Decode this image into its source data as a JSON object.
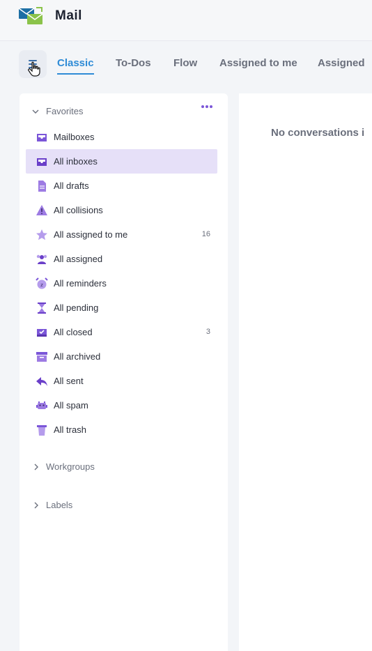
{
  "header": {
    "app_title": "Mail",
    "logo_icon": "mail-logo-icon"
  },
  "tabs": {
    "menu_icon": "hamburger-menu-icon",
    "items": [
      {
        "label": "Classic",
        "active": true
      },
      {
        "label": "To-Dos",
        "active": false
      },
      {
        "label": "Flow",
        "active": false
      },
      {
        "label": "Assigned to me",
        "active": false
      },
      {
        "label": "Assigned",
        "active": false
      }
    ]
  },
  "sidebar": {
    "favorites": {
      "title": "Favorites",
      "more_icon": "more-dots-icon",
      "items": [
        {
          "label": "Mailboxes",
          "icon": "inbox-tray-icon",
          "count": ""
        },
        {
          "label": "All inboxes",
          "icon": "inbox-tray-icon",
          "count": "",
          "selected": true
        },
        {
          "label": "All drafts",
          "icon": "draft-document-icon",
          "count": ""
        },
        {
          "label": "All collisions",
          "icon": "warning-triangle-icon",
          "count": ""
        },
        {
          "label": "All assigned to me",
          "icon": "star-icon",
          "count": "16"
        },
        {
          "label": "All assigned",
          "icon": "people-icon",
          "count": ""
        },
        {
          "label": "All reminders",
          "icon": "alarm-clock-icon",
          "count": ""
        },
        {
          "label": "All pending",
          "icon": "hourglass-icon",
          "count": ""
        },
        {
          "label": "All closed",
          "icon": "closed-tray-icon",
          "count": "3"
        },
        {
          "label": "All archived",
          "icon": "archive-box-icon",
          "count": ""
        },
        {
          "label": "All sent",
          "icon": "reply-arrow-icon",
          "count": ""
        },
        {
          "label": "All spam",
          "icon": "spam-monster-icon",
          "count": ""
        },
        {
          "label": "All trash",
          "icon": "trash-icon",
          "count": ""
        }
      ]
    },
    "workgroups": {
      "title": "Workgroups"
    },
    "labels": {
      "title": "Labels"
    }
  },
  "content": {
    "empty_text": "No conversations i"
  },
  "colors": {
    "accent": "#2e8bd6",
    "icon_purple": "#7b56d8",
    "selected_bg": "#e6e0f8"
  }
}
